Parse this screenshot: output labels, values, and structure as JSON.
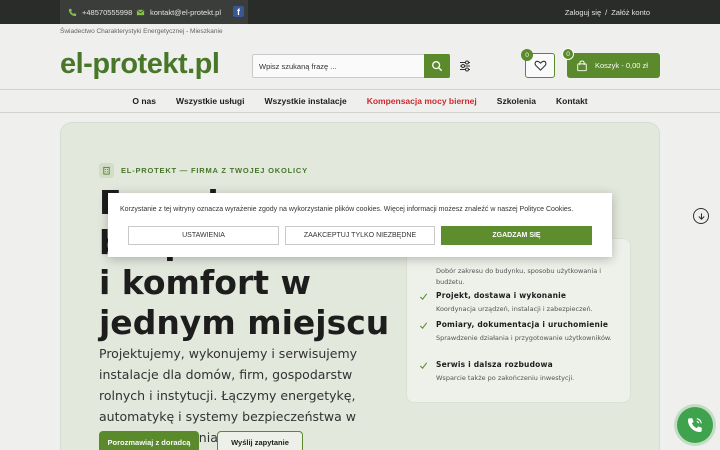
{
  "topbar": {
    "phone": "+48570555998",
    "email": "kontakt@el-protekt.pl",
    "facebook": "f",
    "login": "Zaloguj się",
    "separator": "/",
    "register": "Załóż konto"
  },
  "breadcrumb": "Świadectwo Charakterystyki Energetycznej - Mieszkanie",
  "logo": "el-protekt.pl",
  "search": {
    "placeholder": "Wpisz szukaną frazę ..."
  },
  "wishlist": {
    "count": "0"
  },
  "cart": {
    "count": "0",
    "label": "Koszyk - 0,00 zł"
  },
  "nav": {
    "items": [
      {
        "label": "O nas"
      },
      {
        "label": "Wszystkie usługi"
      },
      {
        "label": "Wszystkie instalacje"
      },
      {
        "label": "Kompensacja mocy biernej"
      },
      {
        "label": "Szkolenia"
      },
      {
        "label": "Kontakt"
      }
    ]
  },
  "hero": {
    "eyebrow": "EL-PROTEKT — FIRMA Z TWOJEJ OKOLICY",
    "title": "Energia, bezpieczeństwo i komfort w jednym miejscu",
    "description": "Projektujemy, wykonujemy i serwisujemy instalacje dla domów, firm, gospodarstw rolnych i instytucji. Łączymy energetykę, automatykę i systemy bezpieczeństwa w spójne rozwiązania.",
    "primary_button": "Porozmawiaj z doradcą",
    "secondary_button": "Wyślij zapytanie"
  },
  "card": {
    "items": [
      {
        "title": "",
        "text": "Dobór zakresu do budynku, sposobu użytkowania i budżetu."
      },
      {
        "title": "Projekt, dostawa i wykonanie",
        "text": "Koordynacja urządzeń, instalacji i zabezpieczeń."
      },
      {
        "title": "Pomiary, dokumentacja i uruchomienie",
        "text": "Sprawdzenie działania i przygotowanie użytkowników."
      },
      {
        "title": "Serwis i dalsza rozbudowa",
        "text": "Wsparcie także po zakończeniu inwestycji."
      }
    ]
  },
  "cookie": {
    "text": "Korzystanie z tej witryny oznacza wyrażenie zgody na wykorzystanie plików cookies. Więcej informacji możesz znaleźć w naszej Polityce Cookies.",
    "settings": "USTAWIENIA",
    "necessary": "ZAAKCEPTUJ TYLKO NIEZBĘDNE",
    "accept": "ZGADZAM SIĘ"
  },
  "colors": {
    "brand": "#5d8d2d",
    "highlight": "#d3282e",
    "topbar": "#2b2d2b"
  }
}
